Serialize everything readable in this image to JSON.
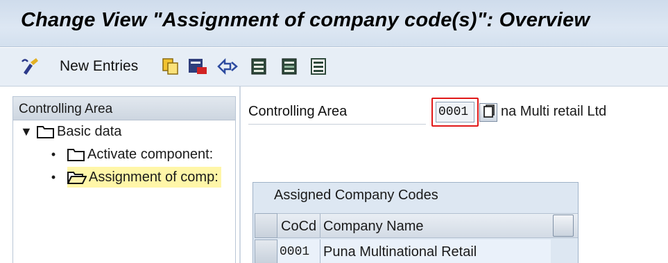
{
  "window": {
    "title": "Change View \"Assignment of company code(s)\": Overview"
  },
  "toolbar": {
    "items": [
      {
        "name": "display-change-icon"
      },
      {
        "name": "new-entries-icon",
        "label": "New Entries"
      },
      {
        "name": "copy-as-icon"
      },
      {
        "name": "delete-icon"
      },
      {
        "name": "undo-change-icon"
      },
      {
        "name": "select-all-icon"
      },
      {
        "name": "select-block-icon"
      },
      {
        "name": "deselect-all-icon"
      }
    ]
  },
  "nav": {
    "header": "Controlling Area",
    "items": [
      {
        "label": "Basic data",
        "level": 0,
        "expanded": true,
        "selected": false
      },
      {
        "label": "Activate component:",
        "level": 1,
        "selected": false
      },
      {
        "label": "Assignment of comp:",
        "level": 1,
        "selected": true
      }
    ]
  },
  "detail": {
    "controlling_area_label": "Controlling Area",
    "controlling_area_value": "0001",
    "controlling_area_desc": "na Multi retail Ltd"
  },
  "table": {
    "title": "Assigned Company Codes",
    "columns": [
      "CoCd",
      "Company Name"
    ],
    "rows": [
      {
        "cocd": "0001",
        "company_name": "Puna Multinational Retail"
      }
    ]
  },
  "colors": {
    "title_bar": "#d6e2f0",
    "selection_highlight": "#fff6a8",
    "focus_border": "#e01818",
    "folder_yellow": "#f6d44a"
  }
}
